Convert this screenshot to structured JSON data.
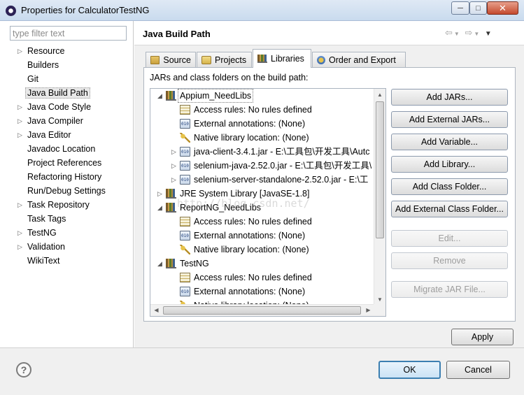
{
  "window": {
    "title": "Properties for CalculatorTestNG",
    "min_label": "─",
    "max_label": "□",
    "close_label": "✕"
  },
  "filter": {
    "placeholder": "type filter text",
    "value": ""
  },
  "pref_tree": [
    {
      "label": "Resource",
      "expandable": true
    },
    {
      "label": "Builders",
      "expandable": false
    },
    {
      "label": "Git",
      "expandable": false
    },
    {
      "label": "Java Build Path",
      "expandable": false,
      "selected": true
    },
    {
      "label": "Java Code Style",
      "expandable": true
    },
    {
      "label": "Java Compiler",
      "expandable": true
    },
    {
      "label": "Java Editor",
      "expandable": true
    },
    {
      "label": "Javadoc Location",
      "expandable": false
    },
    {
      "label": "Project References",
      "expandable": false
    },
    {
      "label": "Refactoring History",
      "expandable": false
    },
    {
      "label": "Run/Debug Settings",
      "expandable": false
    },
    {
      "label": "Task Repository",
      "expandable": true
    },
    {
      "label": "Task Tags",
      "expandable": false
    },
    {
      "label": "TestNG",
      "expandable": true
    },
    {
      "label": "Validation",
      "expandable": true
    },
    {
      "label": "WikiText",
      "expandable": false
    }
  ],
  "page": {
    "title": "Java Build Path",
    "nav_icons": [
      "back-arrow-icon",
      "dropdown-icon",
      "forward-arrow-icon",
      "dropdown-icon",
      "view-menu-icon"
    ]
  },
  "tabs": [
    {
      "label": "Source",
      "icon": "source-folder-icon",
      "active": false
    },
    {
      "label": "Projects",
      "icon": "projects-icon",
      "active": false
    },
    {
      "label": "Libraries",
      "icon": "libraries-icon",
      "active": true
    },
    {
      "label": "Order and Export",
      "icon": "order-export-icon",
      "active": false
    }
  ],
  "libraries": {
    "caption": "JARs and class folders on the build path:",
    "rows": [
      {
        "level": 0,
        "expander": "open",
        "icon": "library-icon",
        "text": "Appium_NeedLibs",
        "selected": true
      },
      {
        "level": 1,
        "expander": "none",
        "icon": "access-rules-icon",
        "text": "Access rules: No rules defined"
      },
      {
        "level": 1,
        "expander": "none",
        "icon": "jar-icon",
        "text": "External annotations: (None)"
      },
      {
        "level": 1,
        "expander": "none",
        "icon": "native-library-icon",
        "text": "Native library location: (None)"
      },
      {
        "level": 1,
        "expander": "closed",
        "icon": "jar-icon",
        "text": "java-client-3.4.1.jar - E:\\工具包\\开发工具\\Autc"
      },
      {
        "level": 1,
        "expander": "closed",
        "icon": "jar-icon",
        "text": "selenium-java-2.52.0.jar - E:\\工具包\\开发工具\\"
      },
      {
        "level": 1,
        "expander": "closed",
        "icon": "jar-icon",
        "text": "selenium-server-standalone-2.52.0.jar - E:\\工"
      },
      {
        "level": 0,
        "expander": "closed",
        "icon": "library-icon",
        "text": "JRE System Library [JavaSE-1.8]"
      },
      {
        "level": 0,
        "expander": "open",
        "icon": "library-icon",
        "text": "ReportNG_NeedLibs"
      },
      {
        "level": 1,
        "expander": "none",
        "icon": "access-rules-icon",
        "text": "Access rules: No rules defined"
      },
      {
        "level": 1,
        "expander": "none",
        "icon": "jar-icon",
        "text": "External annotations: (None)"
      },
      {
        "level": 1,
        "expander": "none",
        "icon": "native-library-icon",
        "text": "Native library location: (None)"
      },
      {
        "level": 0,
        "expander": "open",
        "icon": "library-icon",
        "text": "TestNG"
      },
      {
        "level": 1,
        "expander": "none",
        "icon": "access-rules-icon",
        "text": "Access rules: No rules defined"
      },
      {
        "level": 1,
        "expander": "none",
        "icon": "jar-icon",
        "text": "External annotations: (None)"
      },
      {
        "level": 1,
        "expander": "none",
        "icon": "native-library-icon",
        "text": "Native library location: (None)"
      }
    ]
  },
  "buttons": [
    {
      "label": "Add JARs...",
      "enabled": true
    },
    {
      "label": "Add External JARs...",
      "enabled": true
    },
    {
      "label": "Add Variable...",
      "enabled": true
    },
    {
      "label": "Add Library...",
      "enabled": true
    },
    {
      "label": "Add Class Folder...",
      "enabled": true
    },
    {
      "label": "Add External Class Folder...",
      "enabled": true
    },
    {
      "label": "Edit...",
      "enabled": false
    },
    {
      "label": "Remove",
      "enabled": false
    },
    {
      "label": "Migrate JAR File...",
      "enabled": false
    }
  ],
  "apply_label": "Apply",
  "ok_label": "OK",
  "cancel_label": "Cancel",
  "help_label": "?",
  "watermark": "http://blog.csdn.net/"
}
